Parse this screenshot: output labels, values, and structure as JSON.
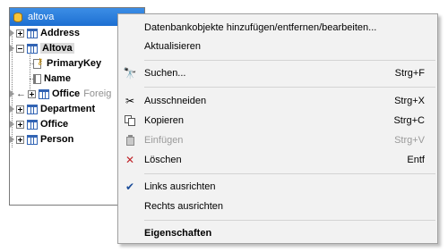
{
  "window": {
    "title": "altova",
    "tree": [
      {
        "label": "Address",
        "expanded": false
      },
      {
        "label": "Altova",
        "expanded": true
      },
      {
        "label": "PrimaryKey"
      },
      {
        "label": "Name"
      },
      {
        "label": "Office",
        "note": "Foreig"
      },
      {
        "label": "Department",
        "expanded": false
      },
      {
        "label": "Office",
        "expanded": false
      },
      {
        "label": "Person",
        "expanded": false
      }
    ]
  },
  "context_menu": {
    "items": [
      {
        "label": "Datenbankobjekte hinzufügen/entfernen/bearbeiten...",
        "shortcut": "",
        "icon": ""
      },
      {
        "label": "Aktualisieren",
        "shortcut": "",
        "icon": ""
      },
      {
        "label": "Suchen...",
        "shortcut": "Strg+F",
        "icon": "binoculars-icon"
      },
      {
        "label": "Ausschneiden",
        "shortcut": "Strg+X",
        "icon": "scissors-icon"
      },
      {
        "label": "Kopieren",
        "shortcut": "Strg+C",
        "icon": "copy-icon"
      },
      {
        "label": "Einfügen",
        "shortcut": "Strg+V",
        "icon": "clipboard-icon",
        "disabled": true
      },
      {
        "label": "Löschen",
        "shortcut": "Entf",
        "icon": "delete-x-icon"
      },
      {
        "label": "Links ausrichten",
        "shortcut": "",
        "icon": "checkmark-icon",
        "checked": true
      },
      {
        "label": "Rechts ausrichten",
        "shortcut": "",
        "icon": ""
      },
      {
        "label": "Eigenschaften",
        "shortcut": "",
        "icon": "",
        "bold": true
      }
    ]
  },
  "colors": {
    "titlebar": "#1d6fd1",
    "menu_bg": "#f2f2f2",
    "disabled_text": "#9a9a9a"
  }
}
